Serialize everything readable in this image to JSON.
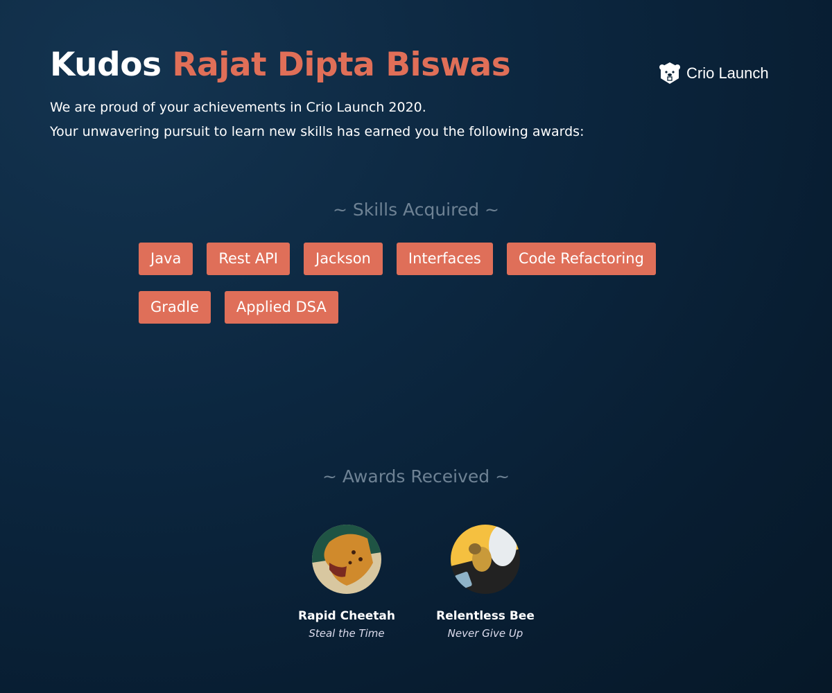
{
  "header": {
    "greeting": "Kudos",
    "name": "Rajat Dipta Biswas",
    "line1": "We are proud of your achievements in Crio Launch 2020.",
    "line2": "Your unwavering pursuit to learn new skills has earned you the following awards:"
  },
  "logo": {
    "text": "Crio Launch",
    "icon": "beaver-icon"
  },
  "skills": {
    "heading": "~ Skills Acquired ~",
    "items": [
      "Java",
      "Rest API",
      "Jackson",
      "Interfaces",
      "Code Refactoring",
      "Gradle",
      "Applied DSA"
    ]
  },
  "awards": {
    "heading": "~ Awards Received ~",
    "items": [
      {
        "name": "Rapid Cheetah",
        "tagline": "Steal the Time"
      },
      {
        "name": "Relentless Bee",
        "tagline": "Never Give Up"
      }
    ]
  },
  "colors": {
    "accent": "#df6f59",
    "background": "#0c2740"
  }
}
